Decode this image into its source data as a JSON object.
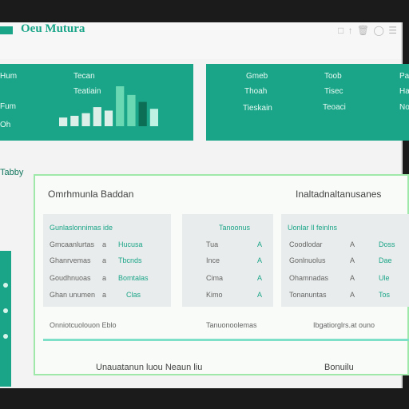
{
  "header": {
    "brand": "Oeu Mutura",
    "tools": "□ ↑ 🗑 ◯ ☰"
  },
  "metric_tiles": [
    {
      "labels": [
        "Hum",
        "Fum",
        "Oh"
      ],
      "values": [
        "Tecan",
        "Teatiain"
      ]
    },
    {
      "columns": [
        [
          "Gmeb",
          "Thoah",
          "Tieskain"
        ],
        [
          "Toob",
          "Tisec",
          "Teoaci"
        ],
        [
          "Pa",
          "Ha",
          "No"
        ]
      ]
    }
  ],
  "mini_chart": {
    "bars": [
      10,
      12,
      15,
      22,
      18,
      46,
      36,
      28,
      20
    ],
    "colors": [
      "#dcefe9",
      "#dcefe9",
      "#dcefe9",
      "#dcefe9",
      "#dcefe9",
      "#6bd8b4",
      "#6bd8b4",
      "#0c6e55",
      "#bff2e3"
    ]
  },
  "sidebar": {
    "title": "Tabby"
  },
  "panel": {
    "title_left": "Omrhmunla Baddan",
    "title_right": "Inaltadnaltanusanes",
    "cards": [
      {
        "header": "Gunlaslonnimas  ide",
        "rows": [
          [
            "Gmcaanlurtas",
            "a",
            "Hucusa"
          ],
          [
            "Ghanrvemas",
            "a",
            "Tbcnds"
          ],
          [
            "Goudhnuoas",
            "a",
            "Bomtalas"
          ],
          [
            "Ghan unumen",
            "a",
            "Clas"
          ]
        ]
      },
      {
        "header": "Tanoonus",
        "rows": [
          [
            "Tua",
            "A"
          ],
          [
            "Ince",
            "A"
          ],
          [
            "Cima",
            "A"
          ],
          [
            "Kimo",
            "A"
          ]
        ]
      },
      {
        "header": "Uonlar Il  feinlns",
        "rows": [
          [
            "Coodlodar",
            "A",
            "Doss"
          ],
          [
            "Gonlnuolus",
            "A",
            "Dae"
          ],
          [
            "Ohamnadas",
            "A",
            "Ule"
          ],
          [
            "Tonanuntas",
            "A",
            "Tos"
          ]
        ]
      }
    ],
    "footer": [
      "Onniotcuolouon  Eblo",
      "Tanuonoolemas",
      "Ibgatiorglrs.at ouno"
    ],
    "bottom_links": [
      "Unauatanun luou Neaun  liu",
      "Bonuilu"
    ]
  }
}
